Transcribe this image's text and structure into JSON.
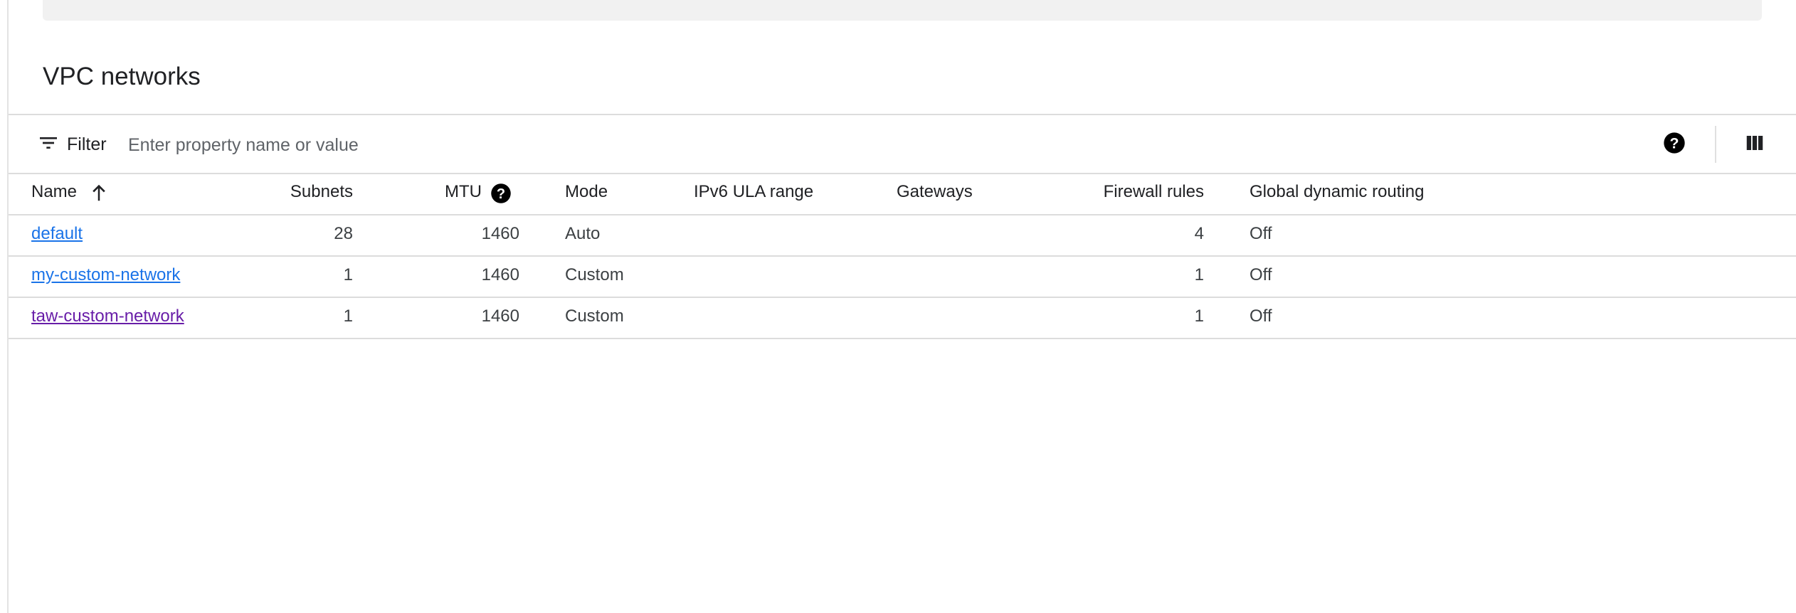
{
  "page": {
    "title": "VPC networks"
  },
  "toolbar": {
    "filter_icon": "filter-list-icon",
    "filter_label": "Filter",
    "filter_placeholder": "Enter property name or value",
    "filter_value": "",
    "help_icon": "help-circle-icon",
    "columns_icon": "column-display-icon"
  },
  "table": {
    "headers": {
      "name": "Name",
      "subnets": "Subnets",
      "mtu": "MTU",
      "mode": "Mode",
      "ipv6": "IPv6 ULA range",
      "gateways": "Gateways",
      "firewall": "Firewall rules",
      "routing": "Global dynamic routing"
    },
    "sort": {
      "column": "name",
      "direction": "ascending",
      "icon": "arrow-up-icon"
    },
    "rows": [
      {
        "name": "default",
        "subnets": "28",
        "mtu": "1460",
        "mode": "Auto",
        "ipv6": "",
        "gateways": "",
        "firewall": "4",
        "routing": "Off",
        "visited": false
      },
      {
        "name": "my-custom-network",
        "subnets": "1",
        "mtu": "1460",
        "mode": "Custom",
        "ipv6": "",
        "gateways": "",
        "firewall": "1",
        "routing": "Off",
        "visited": false
      },
      {
        "name": "taw-custom-network",
        "subnets": "1",
        "mtu": "1460",
        "mode": "Custom",
        "ipv6": "",
        "gateways": "",
        "firewall": "1",
        "routing": "Off",
        "visited": true
      }
    ]
  },
  "colors": {
    "link": "#1a73e8",
    "link_visited": "#681da8",
    "border": "#dcdcdc"
  }
}
